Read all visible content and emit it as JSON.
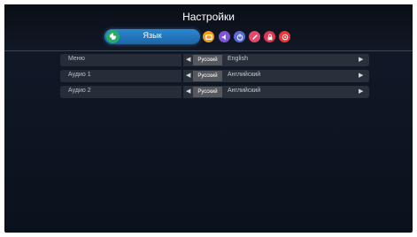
{
  "header": {
    "title": "Настройки",
    "active_tab": {
      "label": "Язык",
      "icon": "globe-icon",
      "color": "#2aa86a"
    },
    "category_icons": [
      {
        "name": "screen-icon",
        "color": "#f29a1a"
      },
      {
        "name": "sound-icon",
        "color": "#7b55d6"
      },
      {
        "name": "power-icon",
        "color": "#5a6bd8"
      },
      {
        "name": "tools-icon",
        "color": "#e5486a"
      },
      {
        "name": "lock-icon",
        "color": "#e23550"
      },
      {
        "name": "support-icon",
        "color": "#e8383c"
      }
    ]
  },
  "settings": [
    {
      "label": "Меню",
      "selected": "Русский",
      "other": "English"
    },
    {
      "label": "Аудио 1",
      "selected": "Русский",
      "other": "Английский"
    },
    {
      "label": "Аудио 2",
      "selected": "Русский",
      "other": "Английский"
    }
  ],
  "glyphs": {
    "left": "◀",
    "right": "▶"
  }
}
